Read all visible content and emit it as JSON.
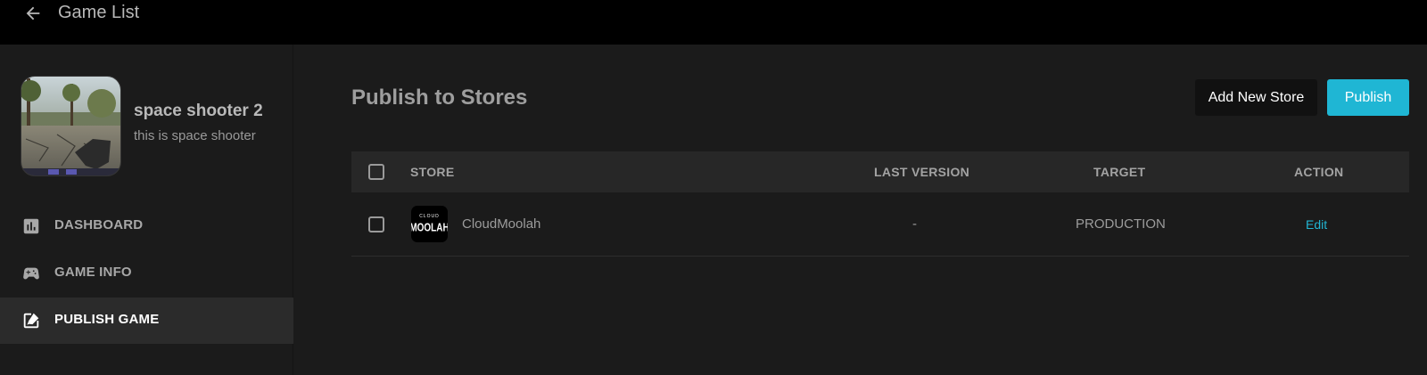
{
  "topbar": {
    "back_icon": "arrow-left-icon",
    "title": "Game List"
  },
  "game": {
    "name": "space shooter 2",
    "description": "this is space shooter"
  },
  "sidebar": {
    "items": [
      {
        "label": "DASHBOARD",
        "icon": "bar-chart-icon",
        "active": false
      },
      {
        "label": "GAME INFO",
        "icon": "gamepad-icon",
        "active": false
      },
      {
        "label": "PUBLISH GAME",
        "icon": "publish-icon",
        "active": true
      }
    ]
  },
  "main": {
    "title": "Publish to Stores",
    "add_store_label": "Add New Store",
    "publish_label": "Publish",
    "table": {
      "headers": {
        "store": "STORE",
        "last_version": "LAST VERSION",
        "target": "TARGET",
        "action": "ACTION"
      },
      "rows": [
        {
          "store": "CloudMoolah",
          "logo_top": "CLOUD",
          "logo_main": "MOOLAH",
          "last_version": "-",
          "target": "PRODUCTION",
          "action": "Edit"
        }
      ]
    }
  },
  "colors": {
    "accent": "#1fb6d4",
    "topbar_bg": "#000000",
    "page_bg": "#1b1b1b",
    "active_nav_bg": "#2b2b2b"
  }
}
